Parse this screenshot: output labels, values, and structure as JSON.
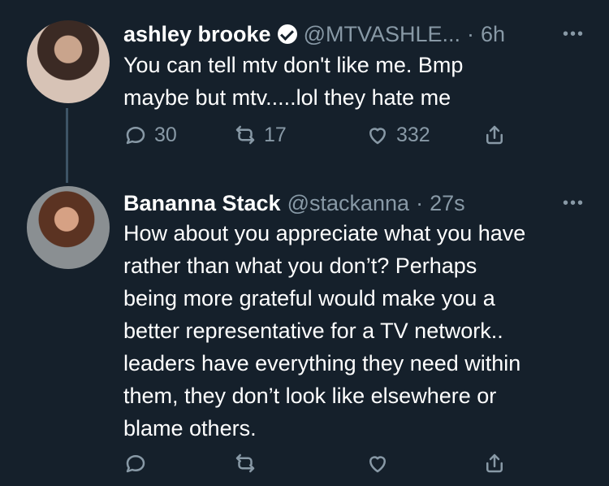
{
  "tweets": [
    {
      "name": "ashley brooke",
      "handle": "@MTVASHLE...",
      "time": "6h",
      "text": "You can tell mtv don't like me. Bmp\nmaybe but mtv.....lol they hate me",
      "counts": {
        "replies": "30",
        "retweets": "17",
        "likes": "332"
      },
      "verified": true
    },
    {
      "name": "Bananna Stack",
      "handle": "@stackanna",
      "time": "27s",
      "text": "How about you appreciate what you have\nrather than what you don’t? Perhaps\nbeing more grateful would make you a\nbetter representative for a TV network..\nleaders have everything they need within\nthem, they don’t look like elsewhere or\nblame others.",
      "counts": {
        "replies": "",
        "retweets": "",
        "likes": ""
      },
      "verified": false
    }
  ],
  "ui": {
    "dot": "·",
    "more": "•••"
  },
  "colors": {
    "background": "#15202b",
    "secondary_text": "#8899a6",
    "primary_text": "#ffffff",
    "thread_line": "#3d5466"
  },
  "icons": {
    "reply": "reply-icon",
    "retweet": "retweet-icon",
    "like": "heart-icon",
    "share": "share-icon",
    "more": "more-icon",
    "verified": "verified-badge-icon"
  }
}
